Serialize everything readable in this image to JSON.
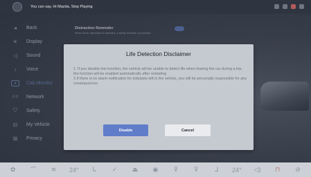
{
  "status_bar": {
    "voice_hint": "You can say, Hi Mazda, Stop Playing"
  },
  "sidebar": {
    "items": [
      {
        "label": "Back",
        "icon": "back-arrow-icon",
        "glyph": "◂"
      },
      {
        "label": "Display",
        "icon": "brightness-icon",
        "glyph": "☀"
      },
      {
        "label": "Sound",
        "icon": "speaker-icon",
        "glyph": "◁"
      },
      {
        "label": "Voice",
        "icon": "microphone-icon",
        "glyph": "♁"
      },
      {
        "label": "Cab Monitor",
        "icon": "cab-monitor-icon",
        "glyph": "▾"
      },
      {
        "label": "Network",
        "icon": "network-icon",
        "glyph": "((·))"
      },
      {
        "label": "Safety",
        "icon": "shield-icon",
        "glyph": "⛉"
      },
      {
        "label": "My Vehicle",
        "icon": "car-icon",
        "glyph": "⊟"
      },
      {
        "label": "Privacy",
        "icon": "privacy-icon",
        "glyph": "⊠"
      }
    ],
    "active_index": 4
  },
  "settings": {
    "reminder_title": "Distraction Reminder",
    "reminder_desc": "When driver distraction is detected, a safety reminder is provided"
  },
  "dialog": {
    "title": "Life Detection Disclaimer",
    "body_line_1": "1. If you disable this function, the vehicle will be unable to detect life when leaving the car during a trip, the function will be enabled automatically after restarting",
    "body_line_2": "2.If there is no alarm notification for kids/pets left in the vehicle, you will be personally responsible for any consequences",
    "disable_label": "Disable",
    "cancel_label": "Cancel"
  },
  "bottom_bar": {
    "items": [
      {
        "icon": "defrost-icon",
        "glyph": "✿"
      },
      {
        "icon": "fan-mode-icon",
        "glyph": "⌒"
      },
      {
        "icon": "seat-heat-icon",
        "glyph": "≋"
      },
      {
        "icon": "temperature-left-icon",
        "glyph": "24°"
      },
      {
        "icon": "seat-icon",
        "glyph": "ᒐ"
      },
      {
        "icon": "airflow-icon",
        "glyph": "✓"
      },
      {
        "icon": "car-recirc-icon",
        "glyph": "⏏"
      },
      {
        "icon": "fan-speed-icon",
        "glyph": "◉"
      },
      {
        "icon": "windshield-icon",
        "glyph": "⊽"
      },
      {
        "icon": "rear-defrost-icon",
        "glyph": "⊽"
      },
      {
        "icon": "seat-right-icon",
        "glyph": "ᒧ"
      },
      {
        "icon": "temperature-right-icon",
        "glyph": "24°"
      },
      {
        "icon": "volume-icon",
        "glyph": "◁)"
      },
      {
        "icon": "lock-icon",
        "glyph": "⊓"
      },
      {
        "icon": "wheel-heat-icon",
        "glyph": "⊘"
      }
    ]
  },
  "colors": {
    "accent": "#5f7dc9",
    "dialog_bg": "#c5c9d0"
  }
}
